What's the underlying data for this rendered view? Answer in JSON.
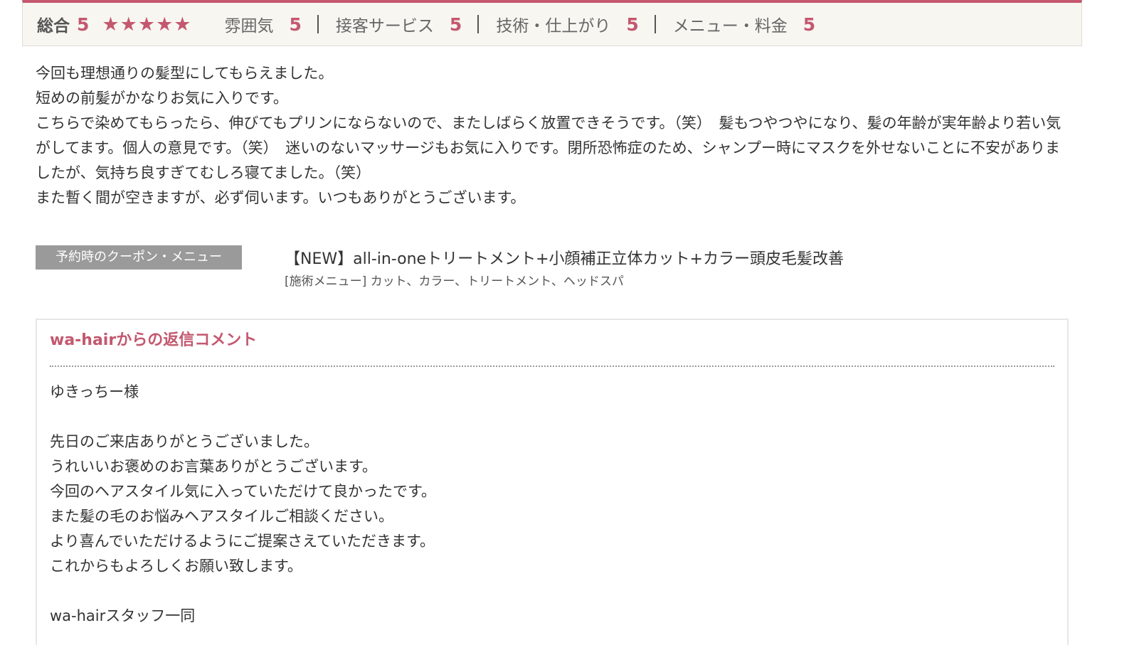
{
  "ratings": {
    "overall_label": "総合",
    "overall_score": "5",
    "stars": [
      "★",
      "★",
      "★",
      "★",
      "★"
    ],
    "categories": [
      {
        "label": "雰囲気",
        "score": "5"
      },
      {
        "label": "接客サービス",
        "score": "5"
      },
      {
        "label": "技術・仕上がり",
        "score": "5"
      },
      {
        "label": "メニュー・料金",
        "score": "5"
      }
    ],
    "accent_color": "#c3586f"
  },
  "review": {
    "lines": [
      "今回も理想通りの髪型にしてもらえました。",
      "短めの前髪がかなりお気に入りです。",
      "こちらで染めてもらったら、伸びてもプリンにならないので、またしばらく放置できそうです。（笑）　髪もつやつやになり、髪の年齢が実年齢より若い気がしてます。個人の意見です。（笑）　迷いのないマッサージもお気に入りです。閉所恐怖症のため、シャンプー時にマスクを外せないことに不安がありましたが、気持ち良すぎてむしろ寝てました。（笑）",
      "また暫く間が空きますが、必ず伺います。いつもありがとうございます。"
    ]
  },
  "coupon": {
    "badge": "予約時のクーポン・メニュー",
    "title": "【NEW】all-in-oneトリートメント+小顔補正立体カット+カラー頭皮毛髪改善",
    "menu": "[施術メニュー] カット、カラー、トリートメント、ヘッドスパ"
  },
  "reply": {
    "title": "wa-hairからの返信コメント",
    "lines": [
      "ゆきっちー様",
      "",
      "先日のご来店ありがとうございました。",
      "うれいいお褒めのお言葉ありがとうございます。",
      "今回のヘアスタイル気に入っていただけて良かったです。",
      "また髪の毛のお悩みヘアスタイルご相談ください。",
      "より喜んでいただけるようにご提案さえていただきます。",
      "これからもよろしくお願い致します。",
      "",
      "wa-hairスタッフ一同"
    ]
  }
}
